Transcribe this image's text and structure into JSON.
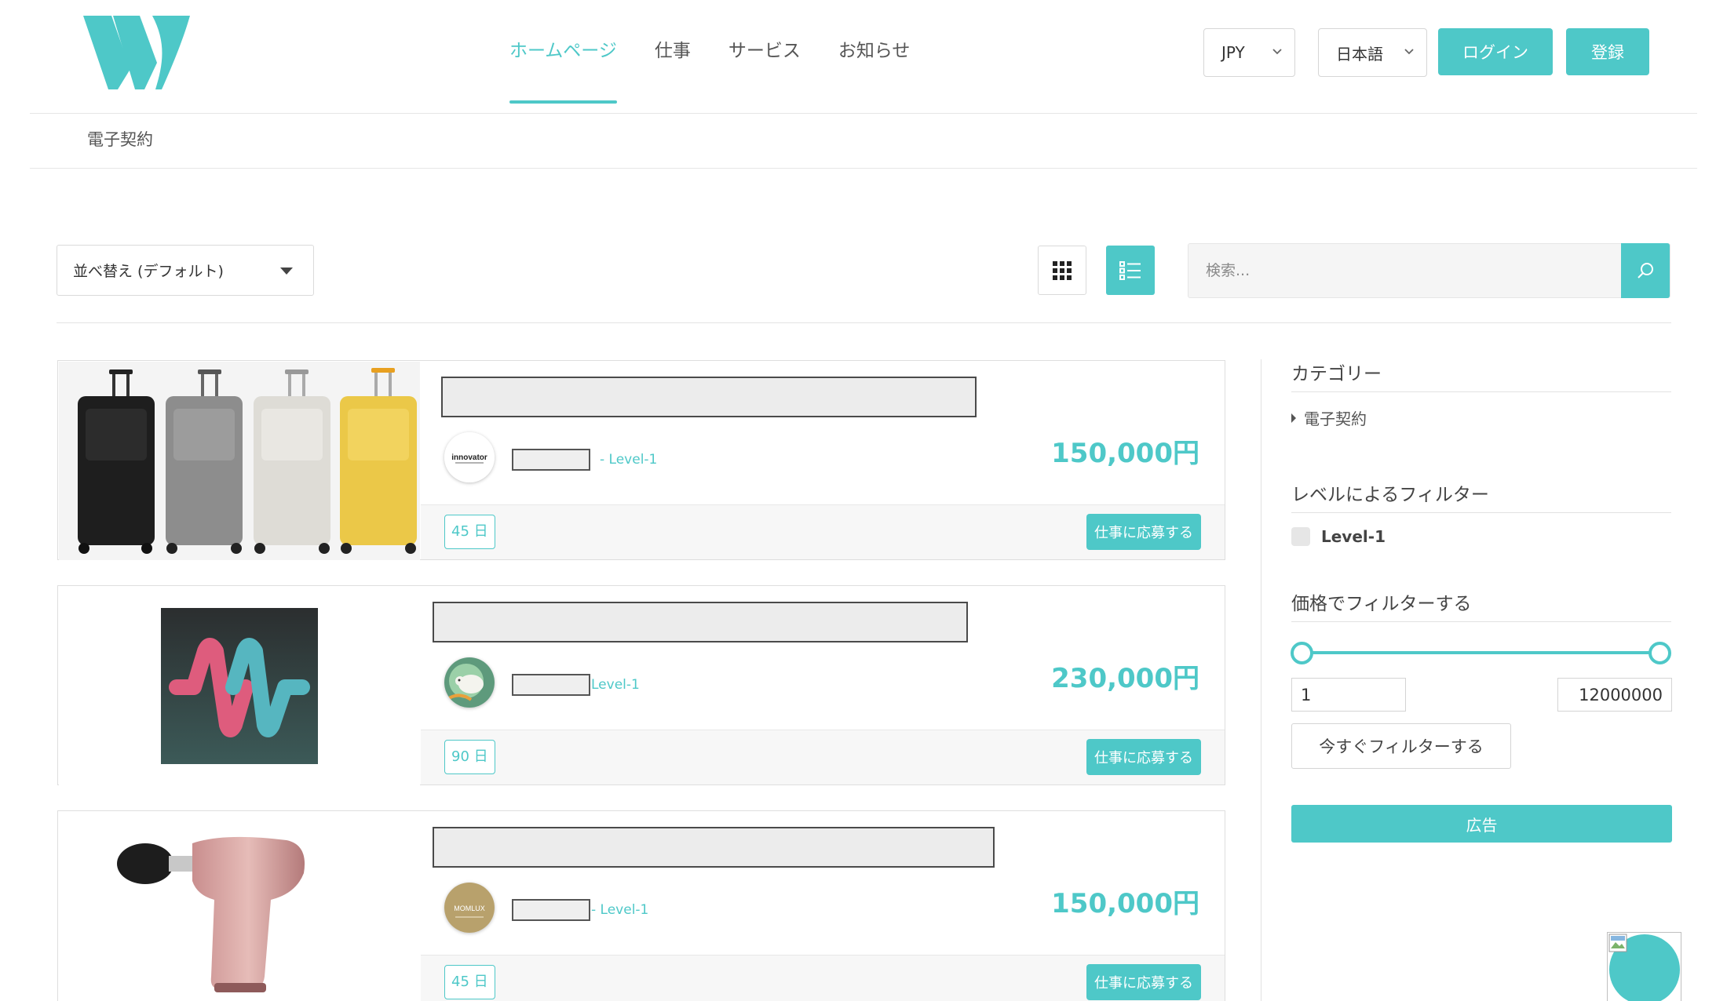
{
  "header": {
    "logo_icon": "w-logo-icon",
    "nav": [
      {
        "label": "ホームページ",
        "active": true
      },
      {
        "label": "仕事",
        "active": false
      },
      {
        "label": "サービス",
        "active": false
      },
      {
        "label": "お知らせ",
        "active": false
      }
    ],
    "currency_select": "JPY",
    "language_select": "日本語",
    "login_label": "ログイン",
    "register_label": "登録"
  },
  "breadcrumb": "電子契約",
  "toolbar": {
    "sort_label": "並べ替え (デフォルト)",
    "grid_view_icon": "grid-icon",
    "list_view_icon": "list-icon",
    "search_placeholder": "検索...",
    "search_icon": "search-icon"
  },
  "listings": [
    {
      "image": "suitcases",
      "avatar": "innovator-logo",
      "avatar_text": "innovator",
      "level": "- Level-1",
      "price": "150,000円",
      "days": "45 日",
      "apply_label": "仕事に応募する"
    },
    {
      "image": "waveform-logo",
      "avatar": "sheep-logo",
      "level": "Level-1",
      "price": "230,000円",
      "days": "90 日",
      "apply_label": "仕事に応募する"
    },
    {
      "image": "massage-gun",
      "avatar": "momlux-logo",
      "avatar_text": "MOMLUX",
      "level": "- Level-1",
      "price": "150,000円",
      "days": "45 日",
      "apply_label": "仕事に応募する"
    }
  ],
  "sidebar": {
    "category_heading": "カテゴリー",
    "categories": [
      "電子契約"
    ],
    "level_heading": "レベルによるフィルター",
    "levels": [
      "Level-1"
    ],
    "price_heading": "価格でフィルターする",
    "price_min": "1",
    "price_max": "12000000",
    "filter_button": "今すぐフィルターする",
    "ad_button": "広告"
  },
  "colors": {
    "accent": "#4ec8c8"
  }
}
